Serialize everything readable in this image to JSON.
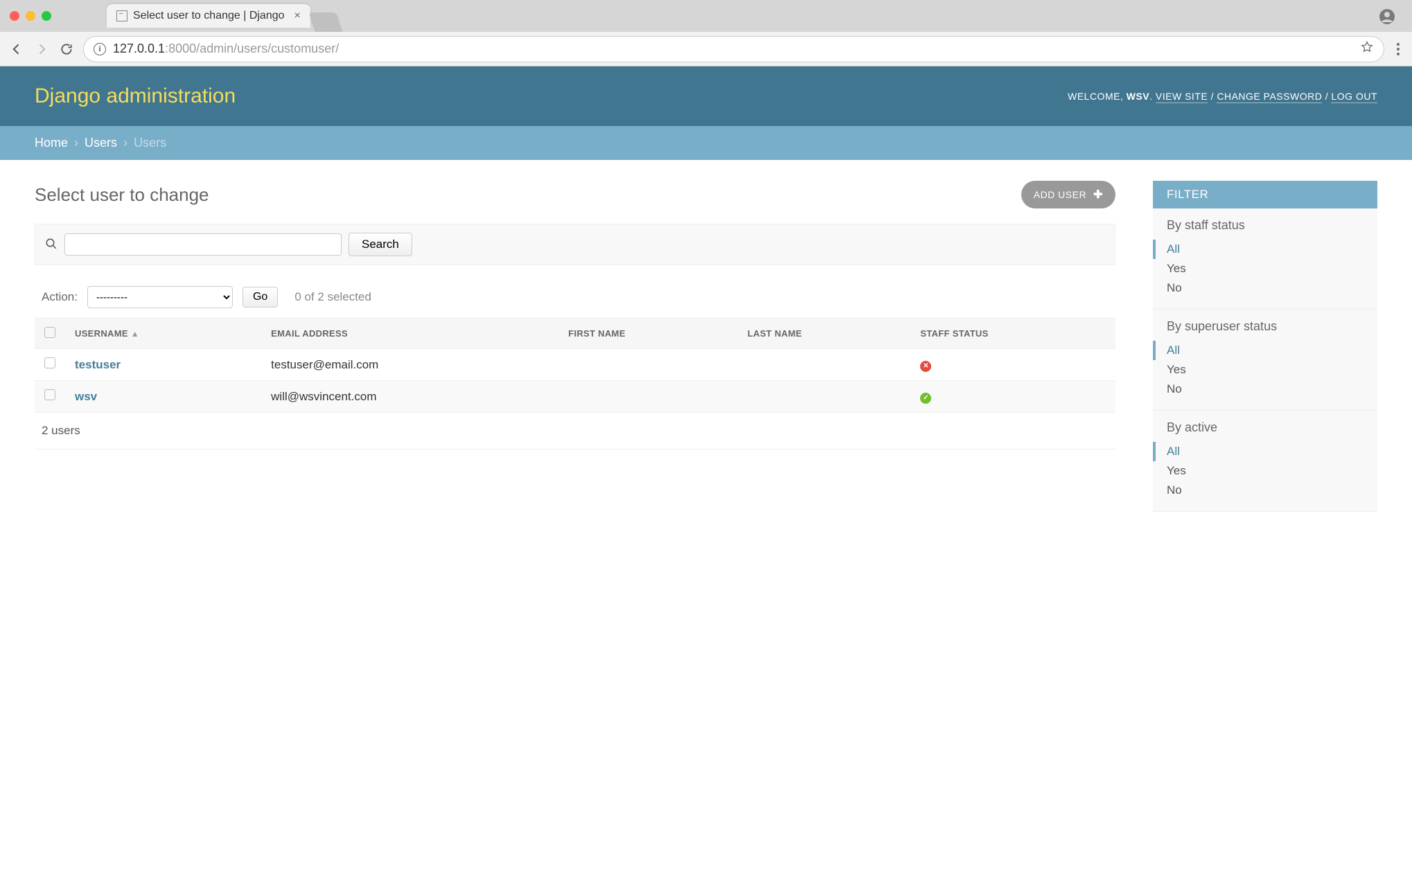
{
  "browser": {
    "tab_title": "Select user to change | Django",
    "url_host": "127.0.0.1",
    "url_port_path": ":8000/admin/users/customuser/"
  },
  "header": {
    "branding": "Django administration",
    "welcome_prefix": "WELCOME, ",
    "username": "WSV",
    "view_site": "VIEW SITE",
    "change_password": "CHANGE PASSWORD",
    "logout": "LOG OUT",
    "sep": " / "
  },
  "breadcrumbs": {
    "home": "Home",
    "users_app": "Users",
    "current": "Users",
    "sep": "›"
  },
  "page": {
    "title": "Select user to change",
    "add_label": "ADD USER"
  },
  "search": {
    "button": "Search"
  },
  "actions": {
    "label": "Action:",
    "placeholder": "---------",
    "go": "Go",
    "selection": "0 of 2 selected"
  },
  "table": {
    "headers": {
      "username": "USERNAME",
      "email": "EMAIL ADDRESS",
      "first_name": "FIRST NAME",
      "last_name": "LAST NAME",
      "staff": "STAFF STATUS"
    },
    "rows": [
      {
        "username": "testuser",
        "email": "testuser@email.com",
        "first_name": "",
        "last_name": "",
        "staff": false
      },
      {
        "username": "wsv",
        "email": "will@wsvincent.com",
        "first_name": "",
        "last_name": "",
        "staff": true
      }
    ],
    "paginator": "2 users"
  },
  "filter": {
    "title": "FILTER",
    "groups": [
      {
        "title": "By staff status",
        "options": [
          "All",
          "Yes",
          "No"
        ],
        "selected": "All"
      },
      {
        "title": "By superuser status",
        "options": [
          "All",
          "Yes",
          "No"
        ],
        "selected": "All"
      },
      {
        "title": "By active",
        "options": [
          "All",
          "Yes",
          "No"
        ],
        "selected": "All"
      }
    ]
  }
}
